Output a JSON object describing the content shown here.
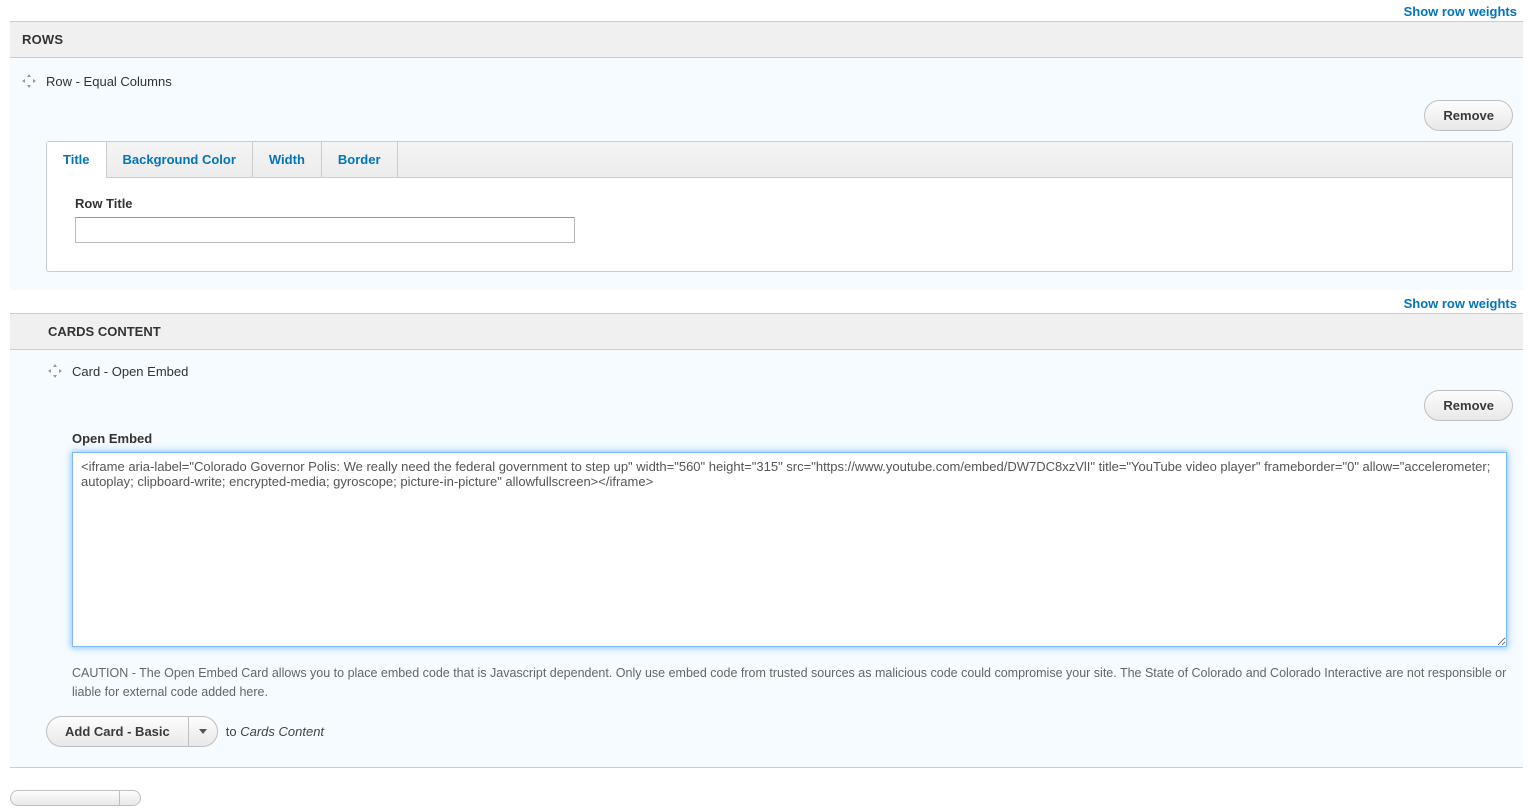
{
  "topLinks": {
    "showRowWeights": "Show row weights"
  },
  "rowsSection": {
    "header": "ROWS",
    "rowLabel": "Row - Equal Columns",
    "removeLabel": "Remove"
  },
  "tabs": {
    "title": "Title",
    "backgroundColor": "Background Color",
    "width": "Width",
    "border": "Border"
  },
  "rowTitleField": {
    "label": "Row Title",
    "value": ""
  },
  "midLinks": {
    "showRowWeights": "Show row weights"
  },
  "cardsSection": {
    "header": "CARDS CONTENT",
    "cardLabel": "Card - Open Embed",
    "removeLabel": "Remove"
  },
  "openEmbed": {
    "label": "Open Embed",
    "value": "<iframe aria-label=\"Colorado Governor Polis: We really need the federal government to step up\" width=\"560\" height=\"315\" src=\"https://www.youtube.com/embed/DW7DC8xzVlI\" title=\"YouTube video player\" frameborder=\"0\" allow=\"accelerometer; autoplay; clipboard-write; encrypted-media; gyroscope; picture-in-picture\" allowfullscreen></iframe>",
    "caution": "CAUTION - The Open Embed Card allows you to place embed code that is Javascript dependent. Only use embed code from trusted sources as malicious code could compromise your site. The State of Colorado and Colorado Interactive are not responsible or liable for external code added here."
  },
  "addCard": {
    "buttonLabel": "Add Card - Basic",
    "toPrefix": "to ",
    "toTarget": "Cards Content"
  }
}
